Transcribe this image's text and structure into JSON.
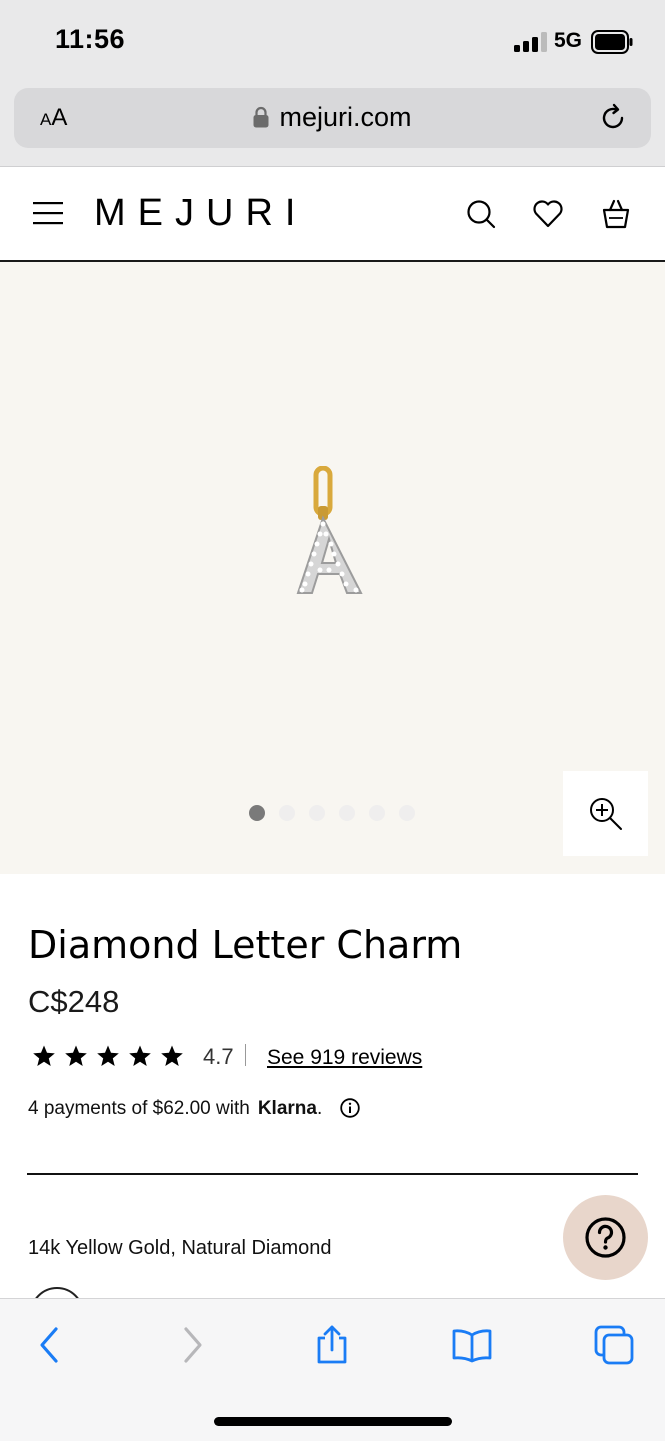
{
  "status_bar": {
    "time": "11:56",
    "network": "5G"
  },
  "browser": {
    "text_size_label_small": "A",
    "text_size_label_large": "A",
    "url": "mejuri.com"
  },
  "header": {
    "logo": "MEJURI"
  },
  "gallery": {
    "total_images": 6,
    "active_index": 0
  },
  "product": {
    "title": "Diamond Letter Charm",
    "price": "C$248",
    "rating": "4.7",
    "rating_stars": 5,
    "reviews_link": "See 919 reviews",
    "payment_text": "4 payments of $62.00 with",
    "payment_brand": "Klarna",
    "payment_brand_suffix": ".",
    "material": "14k Yellow Gold, Natural Diamond"
  },
  "colors": {
    "page_bg": "#ffffff",
    "image_bg": "#f8f6f1",
    "help_button": "#e8d6cb",
    "ios_blue": "#1a7cf5"
  }
}
